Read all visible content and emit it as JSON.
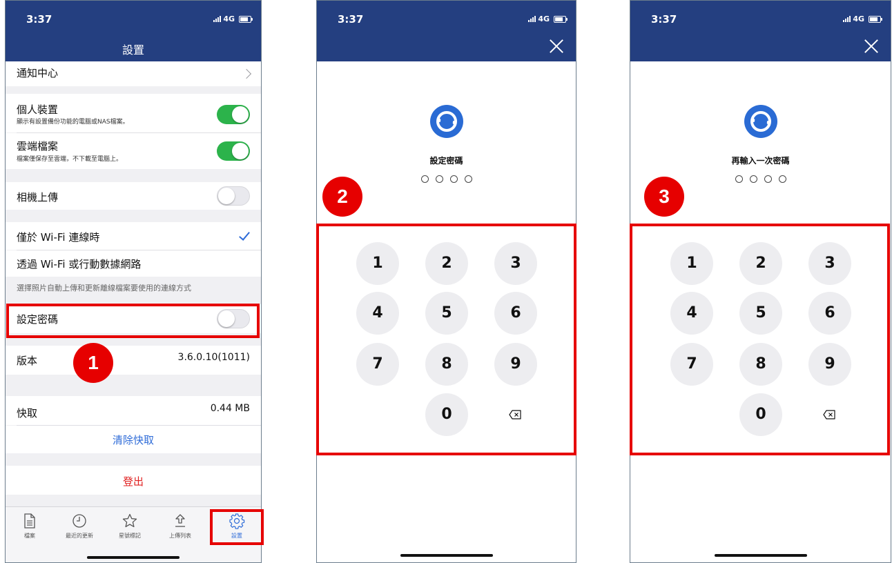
{
  "status_bar": {
    "time": "3:37",
    "network": "4G"
  },
  "settings": {
    "title": "設置",
    "notification_center": "通知中心",
    "personal_devices": {
      "label": "個人裝置",
      "desc": "顯示有設置備份功能的電腦或NAS檔案。",
      "state": "on"
    },
    "cloud_files": {
      "label": "雲端檔案",
      "desc": "檔案僅保存至雲端，不下載至電腦上。",
      "state": "on"
    },
    "camera_upload": {
      "label": "相機上傳",
      "state": "off"
    },
    "wifi_only": "僅於 Wi-Fi 連線時",
    "wifi_or_cellular": "透過 Wi-Fi 或行動數據網路",
    "connection_note": "選擇照片自動上傳和更新離線檔案要使用的連線方式",
    "set_passcode": {
      "label": "設定密碼",
      "state": "off"
    },
    "version": {
      "label": "版本",
      "value": "3.6.0.10(1011)"
    },
    "cache": {
      "label": "快取",
      "value": "0.44 MB"
    },
    "clear_cache": "清除快取",
    "logout": "登出"
  },
  "tabs": [
    {
      "label": "檔案",
      "icon": "file-icon"
    },
    {
      "label": "最近的更新",
      "icon": "clock-icon"
    },
    {
      "label": "星號標記",
      "icon": "star-icon"
    },
    {
      "label": "上傳列表",
      "icon": "upload-icon"
    },
    {
      "label": "設置",
      "icon": "gear-icon",
      "active": true
    }
  ],
  "passcode_set": {
    "title": "設定密碼"
  },
  "passcode_confirm": {
    "title": "再輸入一次密碼"
  },
  "keypad": [
    "1",
    "2",
    "3",
    "4",
    "5",
    "6",
    "7",
    "8",
    "9",
    "0"
  ],
  "steps": [
    "1",
    "2",
    "3"
  ],
  "colors": {
    "header": "#243f80",
    "toggle_on": "#2cb34b",
    "accent": "#2f6cd8",
    "logout": "#e02020",
    "annotation": "#e60000"
  }
}
